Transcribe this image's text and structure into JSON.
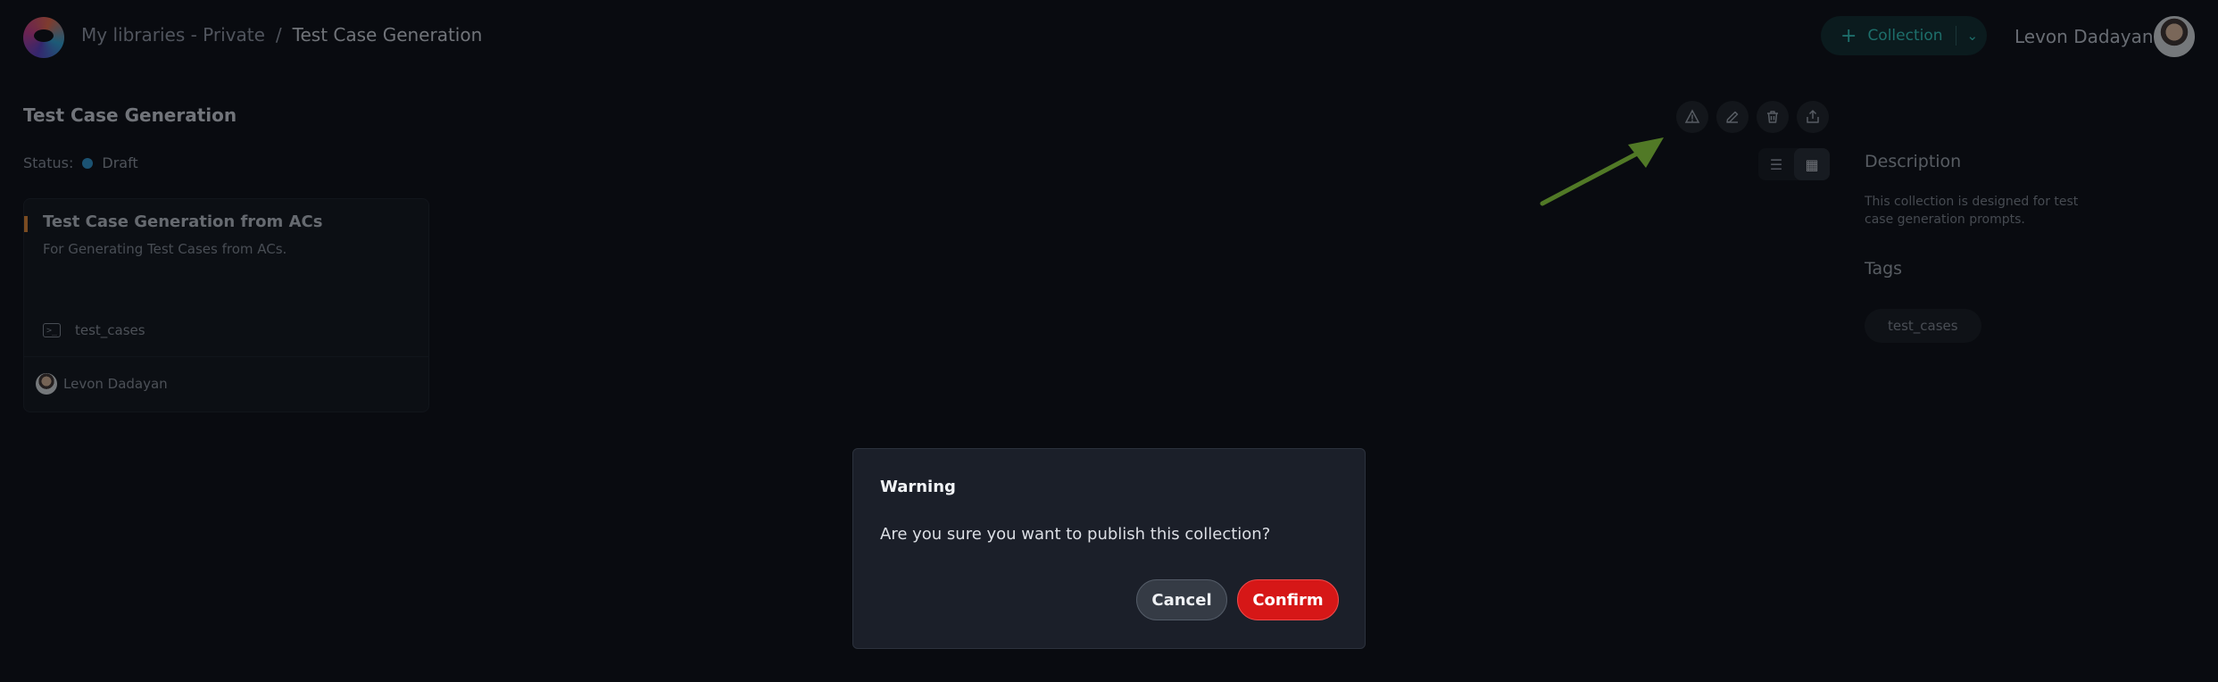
{
  "header": {
    "breadcrumb": {
      "library": "My libraries - Private",
      "separator": "/",
      "current": "Test Case Generation"
    },
    "collection_button": {
      "icon": "plus-icon",
      "label": "Collection",
      "dropdown_icon": "chevron-down-icon"
    },
    "user": {
      "name": "Levon Dadayan"
    }
  },
  "page": {
    "title": "Test Case Generation",
    "status_label": "Status:",
    "status_value": "Draft",
    "status_color": "#2d8fc7",
    "actions": [
      "publish-icon",
      "edit-icon",
      "delete-icon",
      "export-icon"
    ],
    "view_modes": [
      "list-view-icon",
      "grid-view-icon"
    ],
    "active_view": "grid"
  },
  "card": {
    "title": "Test Case Generation from ACs",
    "description": "For Generating Test Cases from ACs.",
    "tag_icon": "terminal-icon",
    "tag": "test_cases",
    "author": "Levon Dadayan",
    "accent_color": "#d98234"
  },
  "sidebar": {
    "description_heading": "Description",
    "description_text": "This collection is designed for test case generation prompts.",
    "tags_heading": "Tags",
    "tags": [
      "test_cases"
    ]
  },
  "modal": {
    "title": "Warning",
    "message": "Are you sure you want to publish this collection?",
    "cancel_label": "Cancel",
    "confirm_label": "Confirm",
    "confirm_color": "#d61717"
  },
  "annotation": {
    "arrow_color": "#8ed63c"
  }
}
